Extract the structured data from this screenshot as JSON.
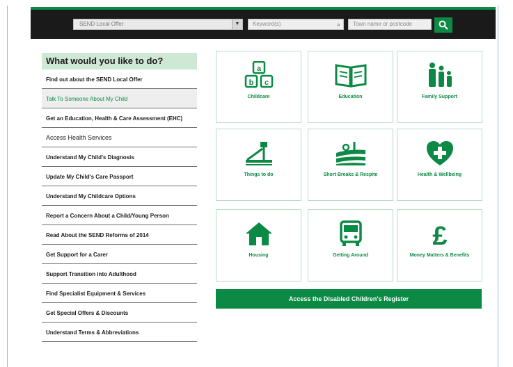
{
  "header": {
    "offer_select": "SEND Local Offer",
    "keyword_placeholder": "Keyword(s)",
    "postcode_placeholder": "Town name or postcode"
  },
  "left_nav": {
    "heading": "What would you like to do?",
    "items": [
      "Find out about the SEND Local Offer",
      "Talk To Someone About My Child",
      "Get an Education, Health & Care Assessment (EHC)",
      "Access Health Services",
      "Understand My Child's Diagnosis",
      "Update My Child's Care Passport",
      "Understand My Childcare Options",
      "Report a Concern About a Child/Young Person",
      "Read About the SEND Reforms of 2014",
      "Get Support for a Carer",
      "Support Transition into Adulthood",
      "Find Specialist Equipment & Services",
      "Get Special Offers & Discounts",
      "Understand Terms & Abbreviations"
    ]
  },
  "tiles": [
    {
      "label": "Childcare",
      "icon": "blocks-icon"
    },
    {
      "label": "Education",
      "icon": "book-icon"
    },
    {
      "label": "Family Support",
      "icon": "family-icon"
    },
    {
      "label": "Things to do",
      "icon": "playground-icon"
    },
    {
      "label": "Short Breaks & Respite",
      "icon": "landscape-icon"
    },
    {
      "label": "Health & Wellbeing",
      "icon": "heart-plus-icon"
    },
    {
      "label": "Housing",
      "icon": "house-icon"
    },
    {
      "label": "Getting Around",
      "icon": "bus-icon"
    },
    {
      "label": "Money Matters & Benefits",
      "icon": "pound-icon"
    }
  ],
  "register_button": "Access the Disabled Children's Register",
  "colors": {
    "brand_green": "#0c8a45",
    "heading_bg": "#cfe7d5",
    "topbar": "#1a1a1a"
  }
}
